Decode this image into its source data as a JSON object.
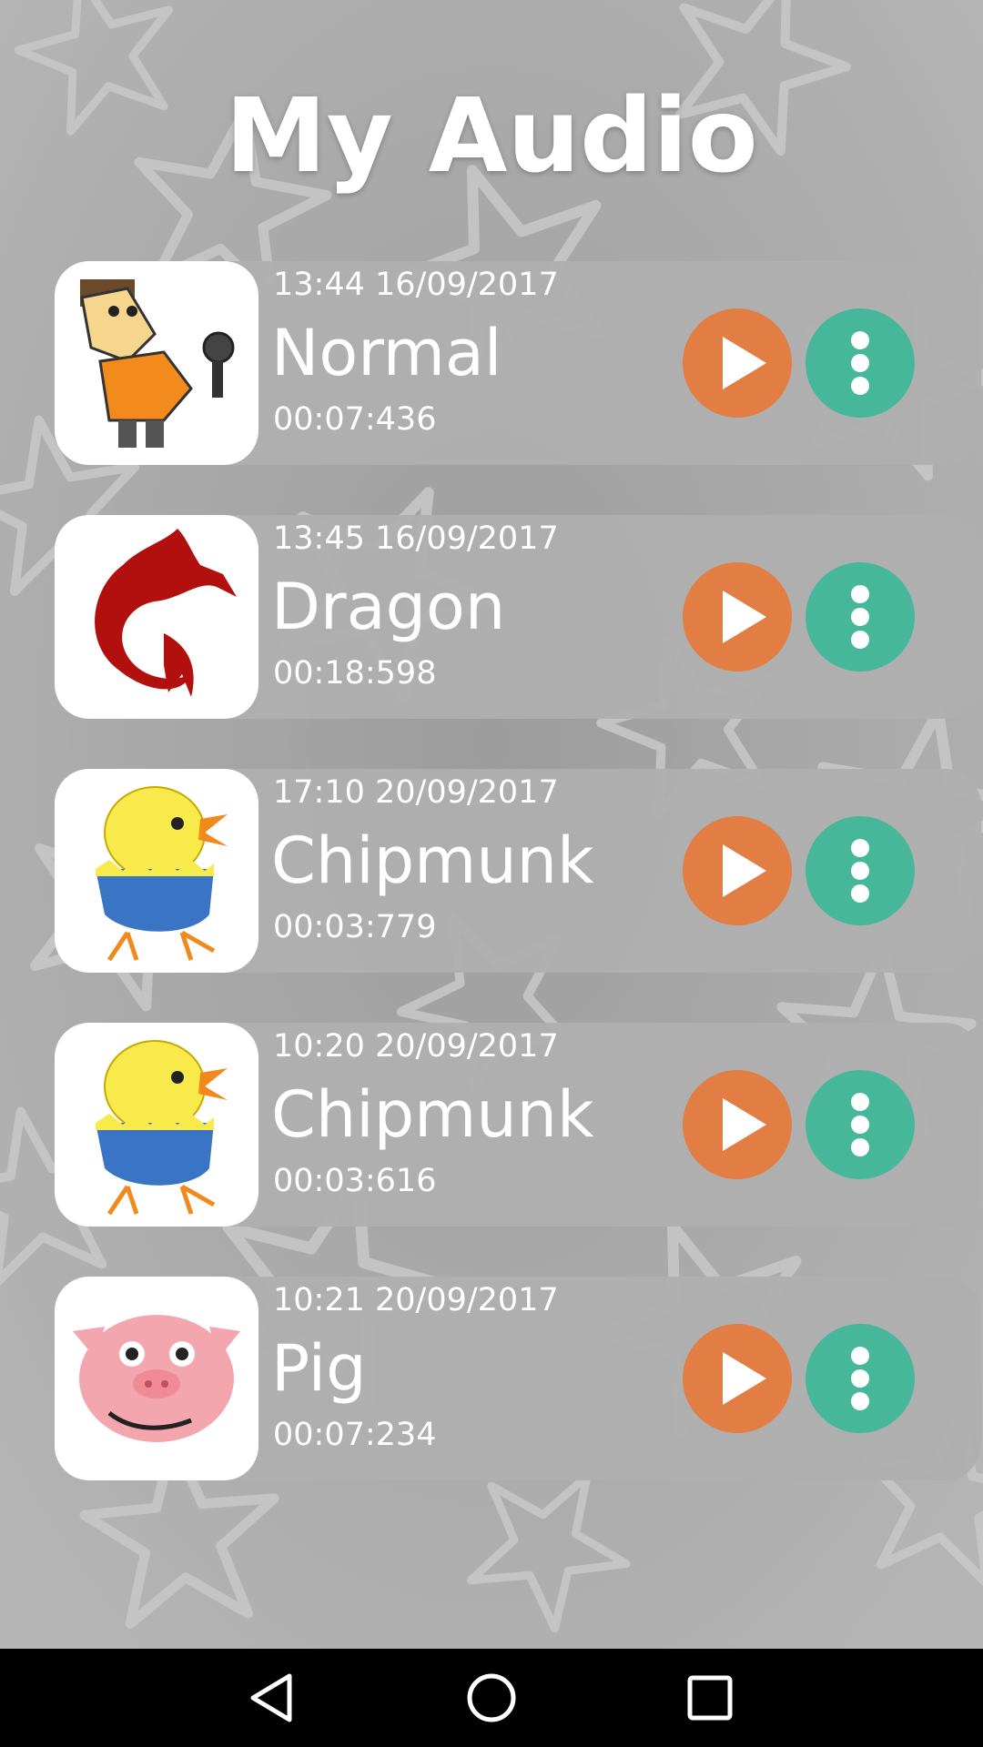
{
  "header": {
    "title": "My Audio"
  },
  "recordings": [
    {
      "timestamp": "13:44 16/09/2017",
      "name": "Normal",
      "duration": "00:07:436",
      "avatar": "singer-avatar"
    },
    {
      "timestamp": "13:45 16/09/2017",
      "name": "Dragon",
      "duration": "00:18:598",
      "avatar": "dragon-avatar"
    },
    {
      "timestamp": "17:10 20/09/2017",
      "name": "Chipmunk",
      "duration": "00:03:779",
      "avatar": "chick-avatar"
    },
    {
      "timestamp": "10:20 20/09/2017",
      "name": "Chipmunk",
      "duration": "00:03:616",
      "avatar": "chick-avatar"
    },
    {
      "timestamp": "10:21 20/09/2017",
      "name": "Pig",
      "duration": "00:07:234",
      "avatar": "pig-avatar"
    }
  ],
  "icons": {
    "play": "play-icon",
    "more": "more-vertical-icon",
    "back": "back-triangle-icon",
    "home": "home-circle-icon",
    "recents": "recents-square-icon"
  },
  "colors": {
    "play_button": "#e27d43",
    "more_button": "#47b79a",
    "card": "#afafaf",
    "navbar": "#000000"
  }
}
